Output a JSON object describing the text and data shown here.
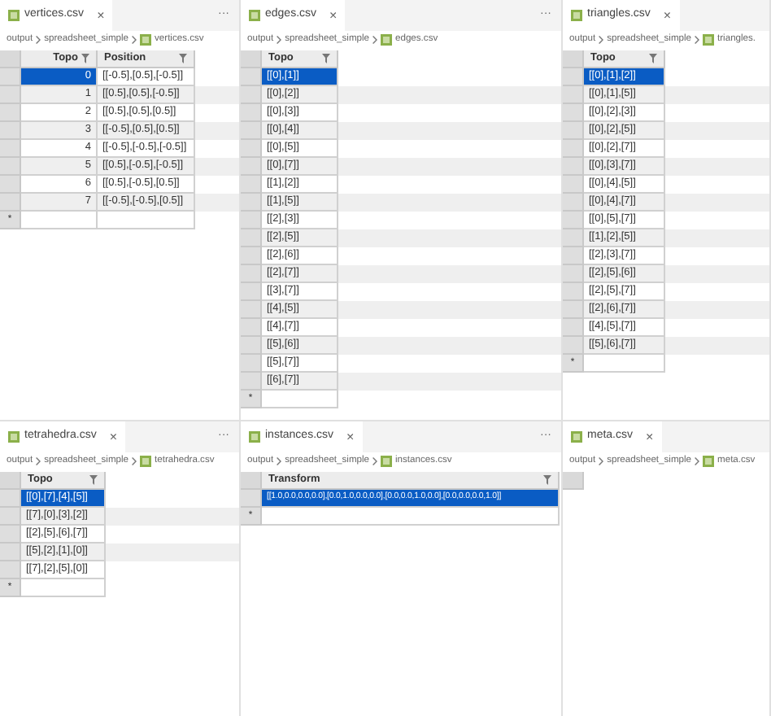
{
  "panes": [
    {
      "tab": {
        "label": "vertices.csv",
        "close": "×"
      },
      "menu": "···",
      "breadcrumb": [
        "output",
        "spreadsheet_simple",
        "vertices.csv"
      ],
      "columns": [
        {
          "label": "Topo",
          "kind": "number"
        },
        {
          "label": "Position",
          "kind": "text"
        }
      ],
      "rows": [
        {
          "cells": [
            "0",
            "[[-0.5],[0.5],[-0.5]]"
          ],
          "selected": true
        },
        {
          "cells": [
            "1",
            "[[0.5],[0.5],[-0.5]]"
          ],
          "selected": false
        },
        {
          "cells": [
            "2",
            "[[0.5],[0.5],[0.5]]"
          ],
          "selected": false
        },
        {
          "cells": [
            "3",
            "[[-0.5],[0.5],[0.5]]"
          ],
          "selected": false
        },
        {
          "cells": [
            "4",
            "[[-0.5],[-0.5],[-0.5]]"
          ],
          "selected": false
        },
        {
          "cells": [
            "5",
            "[[0.5],[-0.5],[-0.5]]"
          ],
          "selected": false
        },
        {
          "cells": [
            "6",
            "[[0.5],[-0.5],[0.5]]"
          ],
          "selected": false
        },
        {
          "cells": [
            "7",
            "[[-0.5],[-0.5],[0.5]]"
          ],
          "selected": false
        }
      ],
      "new_row": "*"
    },
    {
      "tab": {
        "label": "edges.csv",
        "close": "×"
      },
      "menu": "···",
      "breadcrumb": [
        "output",
        "spreadsheet_simple",
        "edges.csv"
      ],
      "columns": [
        {
          "label": "Topo",
          "kind": "text"
        }
      ],
      "rows": [
        {
          "cells": [
            "[[0],[1]]"
          ],
          "selected": true
        },
        {
          "cells": [
            "[[0],[2]]"
          ],
          "selected": false
        },
        {
          "cells": [
            "[[0],[3]]"
          ],
          "selected": false
        },
        {
          "cells": [
            "[[0],[4]]"
          ],
          "selected": false
        },
        {
          "cells": [
            "[[0],[5]]"
          ],
          "selected": false
        },
        {
          "cells": [
            "[[0],[7]]"
          ],
          "selected": false
        },
        {
          "cells": [
            "[[1],[2]]"
          ],
          "selected": false
        },
        {
          "cells": [
            "[[1],[5]]"
          ],
          "selected": false
        },
        {
          "cells": [
            "[[2],[3]]"
          ],
          "selected": false
        },
        {
          "cells": [
            "[[2],[5]]"
          ],
          "selected": false
        },
        {
          "cells": [
            "[[2],[6]]"
          ],
          "selected": false
        },
        {
          "cells": [
            "[[2],[7]]"
          ],
          "selected": false
        },
        {
          "cells": [
            "[[3],[7]]"
          ],
          "selected": false
        },
        {
          "cells": [
            "[[4],[5]]"
          ],
          "selected": false
        },
        {
          "cells": [
            "[[4],[7]]"
          ],
          "selected": false
        },
        {
          "cells": [
            "[[5],[6]]"
          ],
          "selected": false
        },
        {
          "cells": [
            "[[5],[7]]"
          ],
          "selected": false
        },
        {
          "cells": [
            "[[6],[7]]"
          ],
          "selected": false
        }
      ],
      "new_row": "*"
    },
    {
      "tab": {
        "label": "triangles.csv",
        "close": "×"
      },
      "breadcrumb": [
        "output",
        "spreadsheet_simple",
        "triangles."
      ],
      "columns": [
        {
          "label": "Topo",
          "kind": "text"
        }
      ],
      "rows": [
        {
          "cells": [
            "[[0],[1],[2]]"
          ],
          "selected": true
        },
        {
          "cells": [
            "[[0],[1],[5]]"
          ],
          "selected": false
        },
        {
          "cells": [
            "[[0],[2],[3]]"
          ],
          "selected": false
        },
        {
          "cells": [
            "[[0],[2],[5]]"
          ],
          "selected": false
        },
        {
          "cells": [
            "[[0],[2],[7]]"
          ],
          "selected": false
        },
        {
          "cells": [
            "[[0],[3],[7]]"
          ],
          "selected": false
        },
        {
          "cells": [
            "[[0],[4],[5]]"
          ],
          "selected": false
        },
        {
          "cells": [
            "[[0],[4],[7]]"
          ],
          "selected": false
        },
        {
          "cells": [
            "[[0],[5],[7]]"
          ],
          "selected": false
        },
        {
          "cells": [
            "[[1],[2],[5]]"
          ],
          "selected": false
        },
        {
          "cells": [
            "[[2],[3],[7]]"
          ],
          "selected": false
        },
        {
          "cells": [
            "[[2],[5],[6]]"
          ],
          "selected": false
        },
        {
          "cells": [
            "[[2],[5],[7]]"
          ],
          "selected": false
        },
        {
          "cells": [
            "[[2],[6],[7]]"
          ],
          "selected": false
        },
        {
          "cells": [
            "[[4],[5],[7]]"
          ],
          "selected": false
        },
        {
          "cells": [
            "[[5],[6],[7]]"
          ],
          "selected": false
        }
      ],
      "new_row": "*"
    },
    {
      "tab": {
        "label": "tetrahedra.csv",
        "close": "×"
      },
      "menu": "···",
      "breadcrumb": [
        "output",
        "spreadsheet_simple",
        "tetrahedra.csv"
      ],
      "columns": [
        {
          "label": "Topo",
          "kind": "text"
        }
      ],
      "rows": [
        {
          "cells": [
            "[[0],[7],[4],[5]]"
          ],
          "selected": true
        },
        {
          "cells": [
            "[[7],[0],[3],[2]]"
          ],
          "selected": false
        },
        {
          "cells": [
            "[[2],[5],[6],[7]]"
          ],
          "selected": false
        },
        {
          "cells": [
            "[[5],[2],[1],[0]]"
          ],
          "selected": false
        },
        {
          "cells": [
            "[[7],[2],[5],[0]]"
          ],
          "selected": false
        }
      ],
      "new_row": "*"
    },
    {
      "tab": {
        "label": "instances.csv",
        "close": "×"
      },
      "menu": "···",
      "breadcrumb": [
        "output",
        "spreadsheet_simple",
        "instances.csv"
      ],
      "columns": [
        {
          "label": "Transform",
          "kind": "text"
        }
      ],
      "rows": [
        {
          "cells": [
            "[[1.0,0.0,0.0,0.0],[0.0,1.0,0.0,0.0],[0.0,0.0,1.0,0.0],[0.0,0.0,0.0,1.0]]"
          ],
          "selected": true
        }
      ],
      "new_row": "*"
    },
    {
      "tab": {
        "label": "meta.csv",
        "close": "×"
      },
      "breadcrumb": [
        "output",
        "spreadsheet_simple",
        "meta.csv"
      ]
    }
  ]
}
